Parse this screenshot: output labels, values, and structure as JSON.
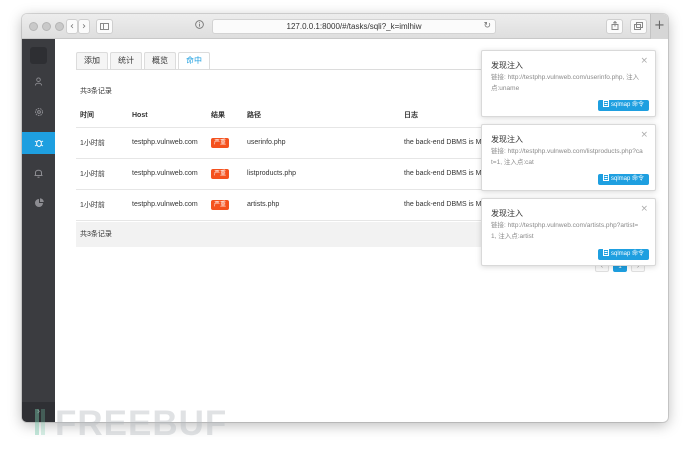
{
  "browser": {
    "url": "127.0.0.1:8000/#/tasks/sqli?_k=imlhiw"
  },
  "tabs": [
    {
      "label": "添加"
    },
    {
      "label": "统计"
    },
    {
      "label": "概览"
    },
    {
      "label": "命中",
      "active": true
    }
  ],
  "summary": {
    "top": "共3条记录",
    "bottom": "共3条记录"
  },
  "table": {
    "headers": [
      "时间",
      "Host",
      "结果",
      "路径",
      "日志"
    ],
    "rows": [
      {
        "time": "1小时前",
        "host": "testphp.vulnweb.com",
        "result": "严重",
        "path": "userinfo.php",
        "log": "the back-end DBMS is MySQL"
      },
      {
        "time": "1小时前",
        "host": "testphp.vulnweb.com",
        "result": "严重",
        "path": "listproducts.php",
        "log": "the back-end DBMS is MySQL"
      },
      {
        "time": "1小时前",
        "host": "testphp.vulnweb.com",
        "result": "严重",
        "path": "artists.php",
        "log": "the back-end DBMS is MySQL"
      }
    ]
  },
  "pagination": {
    "current_page": "1"
  },
  "notifications": [
    {
      "title": "发现注入",
      "body": "链接: http://testphp.vulnweb.com/userinfo.php, 注入点:uname",
      "button": "sqlmap 命令"
    },
    {
      "title": "发现注入",
      "body": "链接: http://testphp.vulnweb.com/listproducts.php?cat=1, 注入点:cat",
      "button": "sqlmap 命令"
    },
    {
      "title": "发现注入",
      "body": "链接: http://testphp.vulnweb.com/artists.php?artist=1, 注入点:artist",
      "button": "sqlmap 命令"
    }
  ],
  "watermark": {
    "text": "FREEBUF"
  },
  "colors": {
    "accent": "#1e9fe0",
    "severity": "#f4511e",
    "sidebar": "#3b3c40"
  },
  "icons": {
    "sidebar": [
      "user-icon",
      "settings-icon",
      "bug-icon",
      "bell-icon",
      "pie-chart-icon",
      "chevron-right-icon"
    ],
    "browser": [
      "back-icon",
      "forward-icon",
      "sidebar-toggle-icon",
      "info-icon",
      "reload-icon",
      "share-icon",
      "tabs-icon",
      "new-tab-icon"
    ]
  }
}
